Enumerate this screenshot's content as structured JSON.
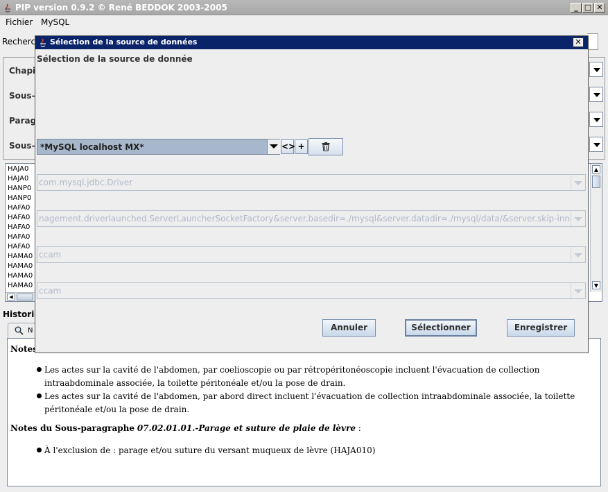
{
  "window": {
    "title": "PIP version 0.9.2 © René BEDDOK 2003-2005",
    "min": "_",
    "max": "□",
    "close": "✕"
  },
  "menu": {
    "items": [
      "Fichier",
      "MySQL"
    ]
  },
  "background": {
    "search_label": "Recherc",
    "labels": [
      "Chapit",
      "Sous-",
      "Paragi",
      "Sous-p"
    ],
    "list_rows": [
      "HAJA0",
      "HAJA0",
      "HANP0",
      "HANP0",
      "HAFA0",
      "HAFA0",
      "HAFA0",
      "HAFA0",
      "HAFA0",
      "HAMA0",
      "HAMA0",
      "HAMA0",
      "HAMA0"
    ],
    "historique_label": "Historiq",
    "tab_label": "N",
    "notes_partial_heading": "Notes"
  },
  "notes": {
    "bullets1": [
      "Les actes sur la cavité de l'abdomen, par coelioscopie ou par rétropéritonéoscopie incluent l'évacuation de collection intraabdominale associée, la toilette péritonéale et/ou la pose de drain.",
      "Les actes sur la cavité de l'abdomen, par abord direct incluent l'évacuation de collection intraabdominale associée, la toilette péritonéale et/ou la pose de drain."
    ],
    "heading2_prefix": "Notes du Sous-paragraphe",
    "heading2_code": "07.02.01.01.-Parage et suture de plaie de lèvre",
    "heading2_suffix": " :",
    "bullets2": [
      "À l'exclusion de : parage et/ou suture du versant muqueux de lèvre (HAJA010)"
    ]
  },
  "dialog": {
    "title": "Sélection de la source de données",
    "close": "✕",
    "heading": "Sélection de la source de donnée",
    "source_selected": "*MySQL localhost MX*",
    "compare_label": "<>",
    "add_label": "+",
    "fields": [
      "com.mysql.jdbc.Driver",
      "nagement.driverlaunched.ServerLauncherSocketFactory&server.basedir=./mysql&server.datadir=./mysql/data/&server.skip-innodb=yes",
      "ccam",
      "ccam"
    ],
    "buttons": {
      "cancel": "Annuler",
      "select": "Sélectionner",
      "save": "Enregistrer"
    }
  }
}
